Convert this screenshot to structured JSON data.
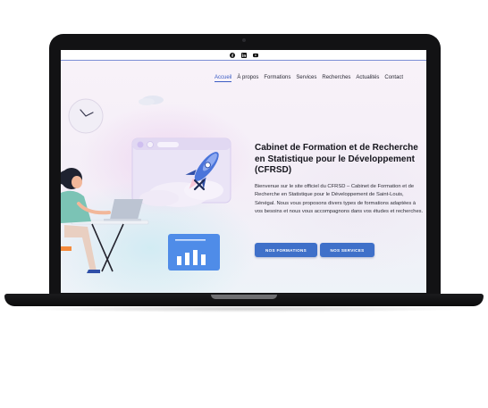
{
  "topbar": {
    "social_icons": [
      "facebook-icon",
      "linkedin-icon",
      "youtube-icon"
    ]
  },
  "nav": {
    "items": [
      "Accueil",
      "À propos",
      "Formations",
      "Services",
      "Recherches",
      "Actualités",
      "Contact"
    ],
    "active": "Accueil"
  },
  "hero": {
    "title": "Cabinet de Formation et de Recherche en Statistique pour le Développement (CFRSD)",
    "description": "Bienvenue sur le site officiel du CFRSD – Cabinet de Formation et de Recherche en Statistique pour le Développement de Saint-Louis, Sénégal. Nous vous proposons divers types de formations adaptées à vos besoins et nous vous accompagnons dans vos études et recherches.",
    "buttons": {
      "formations": "NOS FORMATIONS",
      "services": "NOS SERVICES"
    }
  },
  "colors": {
    "accent": "#3f70c9",
    "laptop_frame": "#121214",
    "nav_active": "#3b5cc4"
  }
}
